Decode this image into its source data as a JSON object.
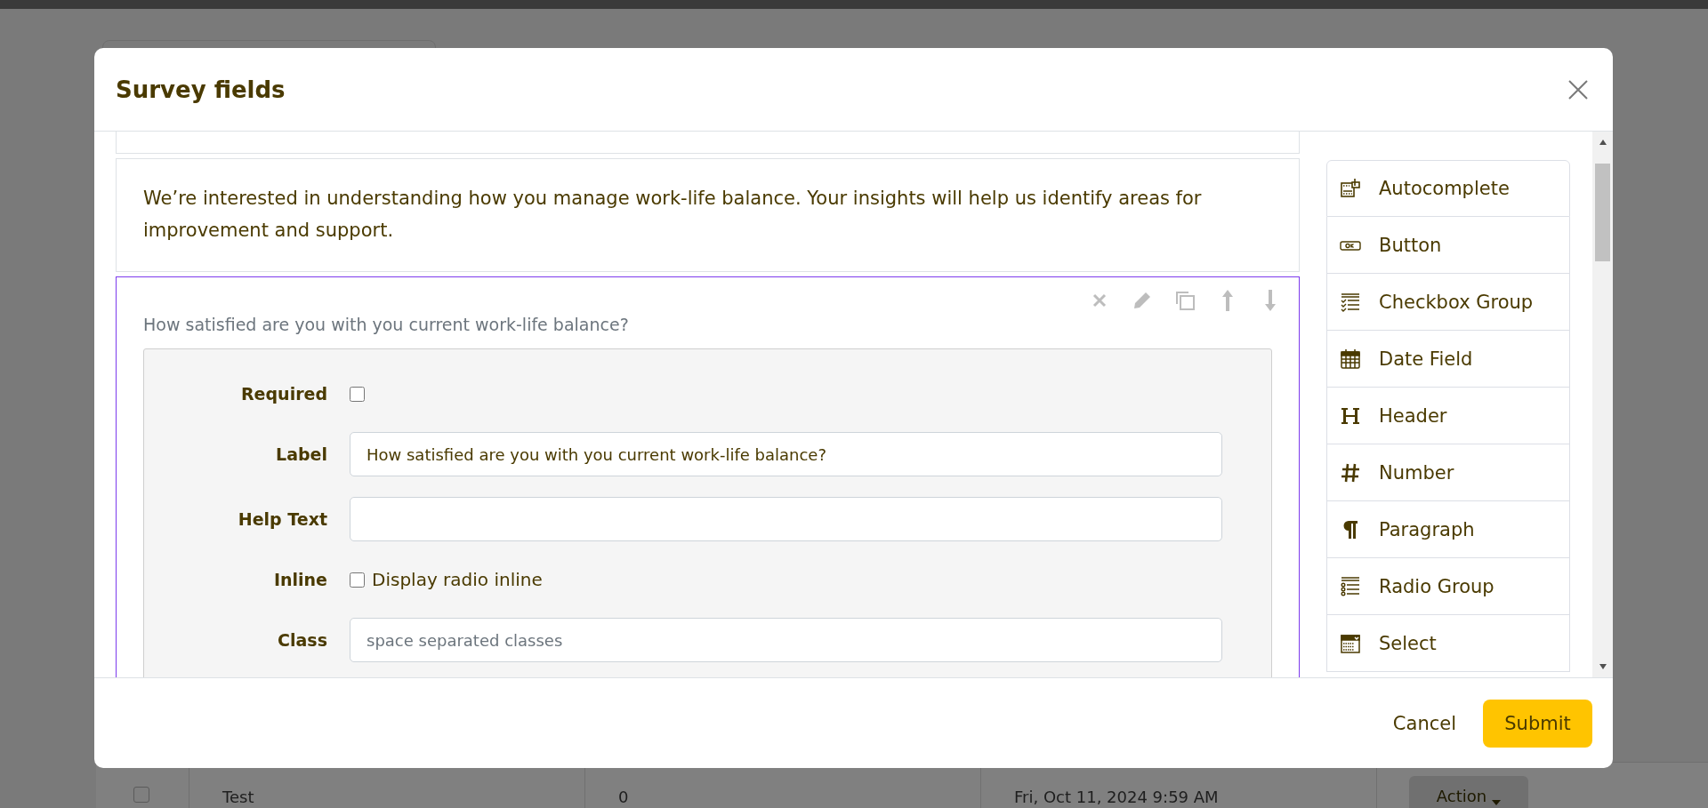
{
  "background_row": {
    "checked": false,
    "cells": [
      "Test",
      "0",
      "Fri, Oct 11, 2024 9:59 AM"
    ],
    "action": "Action"
  },
  "dialog": {
    "title": "Survey fields",
    "description": "We’re interested in understanding how you manage work-life balance. Your insights will help us identify areas for improvement and support.",
    "field": {
      "label": "How satisfied are you with you current work-life balance?",
      "selected": true,
      "settings": [
        {
          "kind": "checkbox",
          "label": "Required",
          "checked": false
        },
        {
          "kind": "text",
          "label": "Label",
          "value": "How satisfied are you with you current work-life balance?"
        },
        {
          "kind": "text",
          "label": "Help Text"
        },
        {
          "kind": "checkbox",
          "label": "Inline",
          "checked": false,
          "option": "Display radio inline"
        },
        {
          "kind": "text",
          "label": "Class",
          "placeholder": "space separated classes"
        }
      ]
    },
    "toolbox": [
      {
        "kind": "autocomplete",
        "label": "Autocomplete"
      },
      {
        "kind": "button",
        "label": "Button"
      },
      {
        "kind": "checkbox-group",
        "label": "Checkbox Group"
      },
      {
        "kind": "date",
        "label": "Date Field"
      },
      {
        "kind": "header",
        "label": "Header"
      },
      {
        "kind": "number",
        "label": "Number"
      },
      {
        "kind": "paragraph",
        "label": "Paragraph"
      },
      {
        "kind": "radio-group",
        "label": "Radio Group"
      },
      {
        "kind": "select",
        "label": "Select"
      }
    ],
    "cancel": "Cancel",
    "submit": "Submit"
  }
}
